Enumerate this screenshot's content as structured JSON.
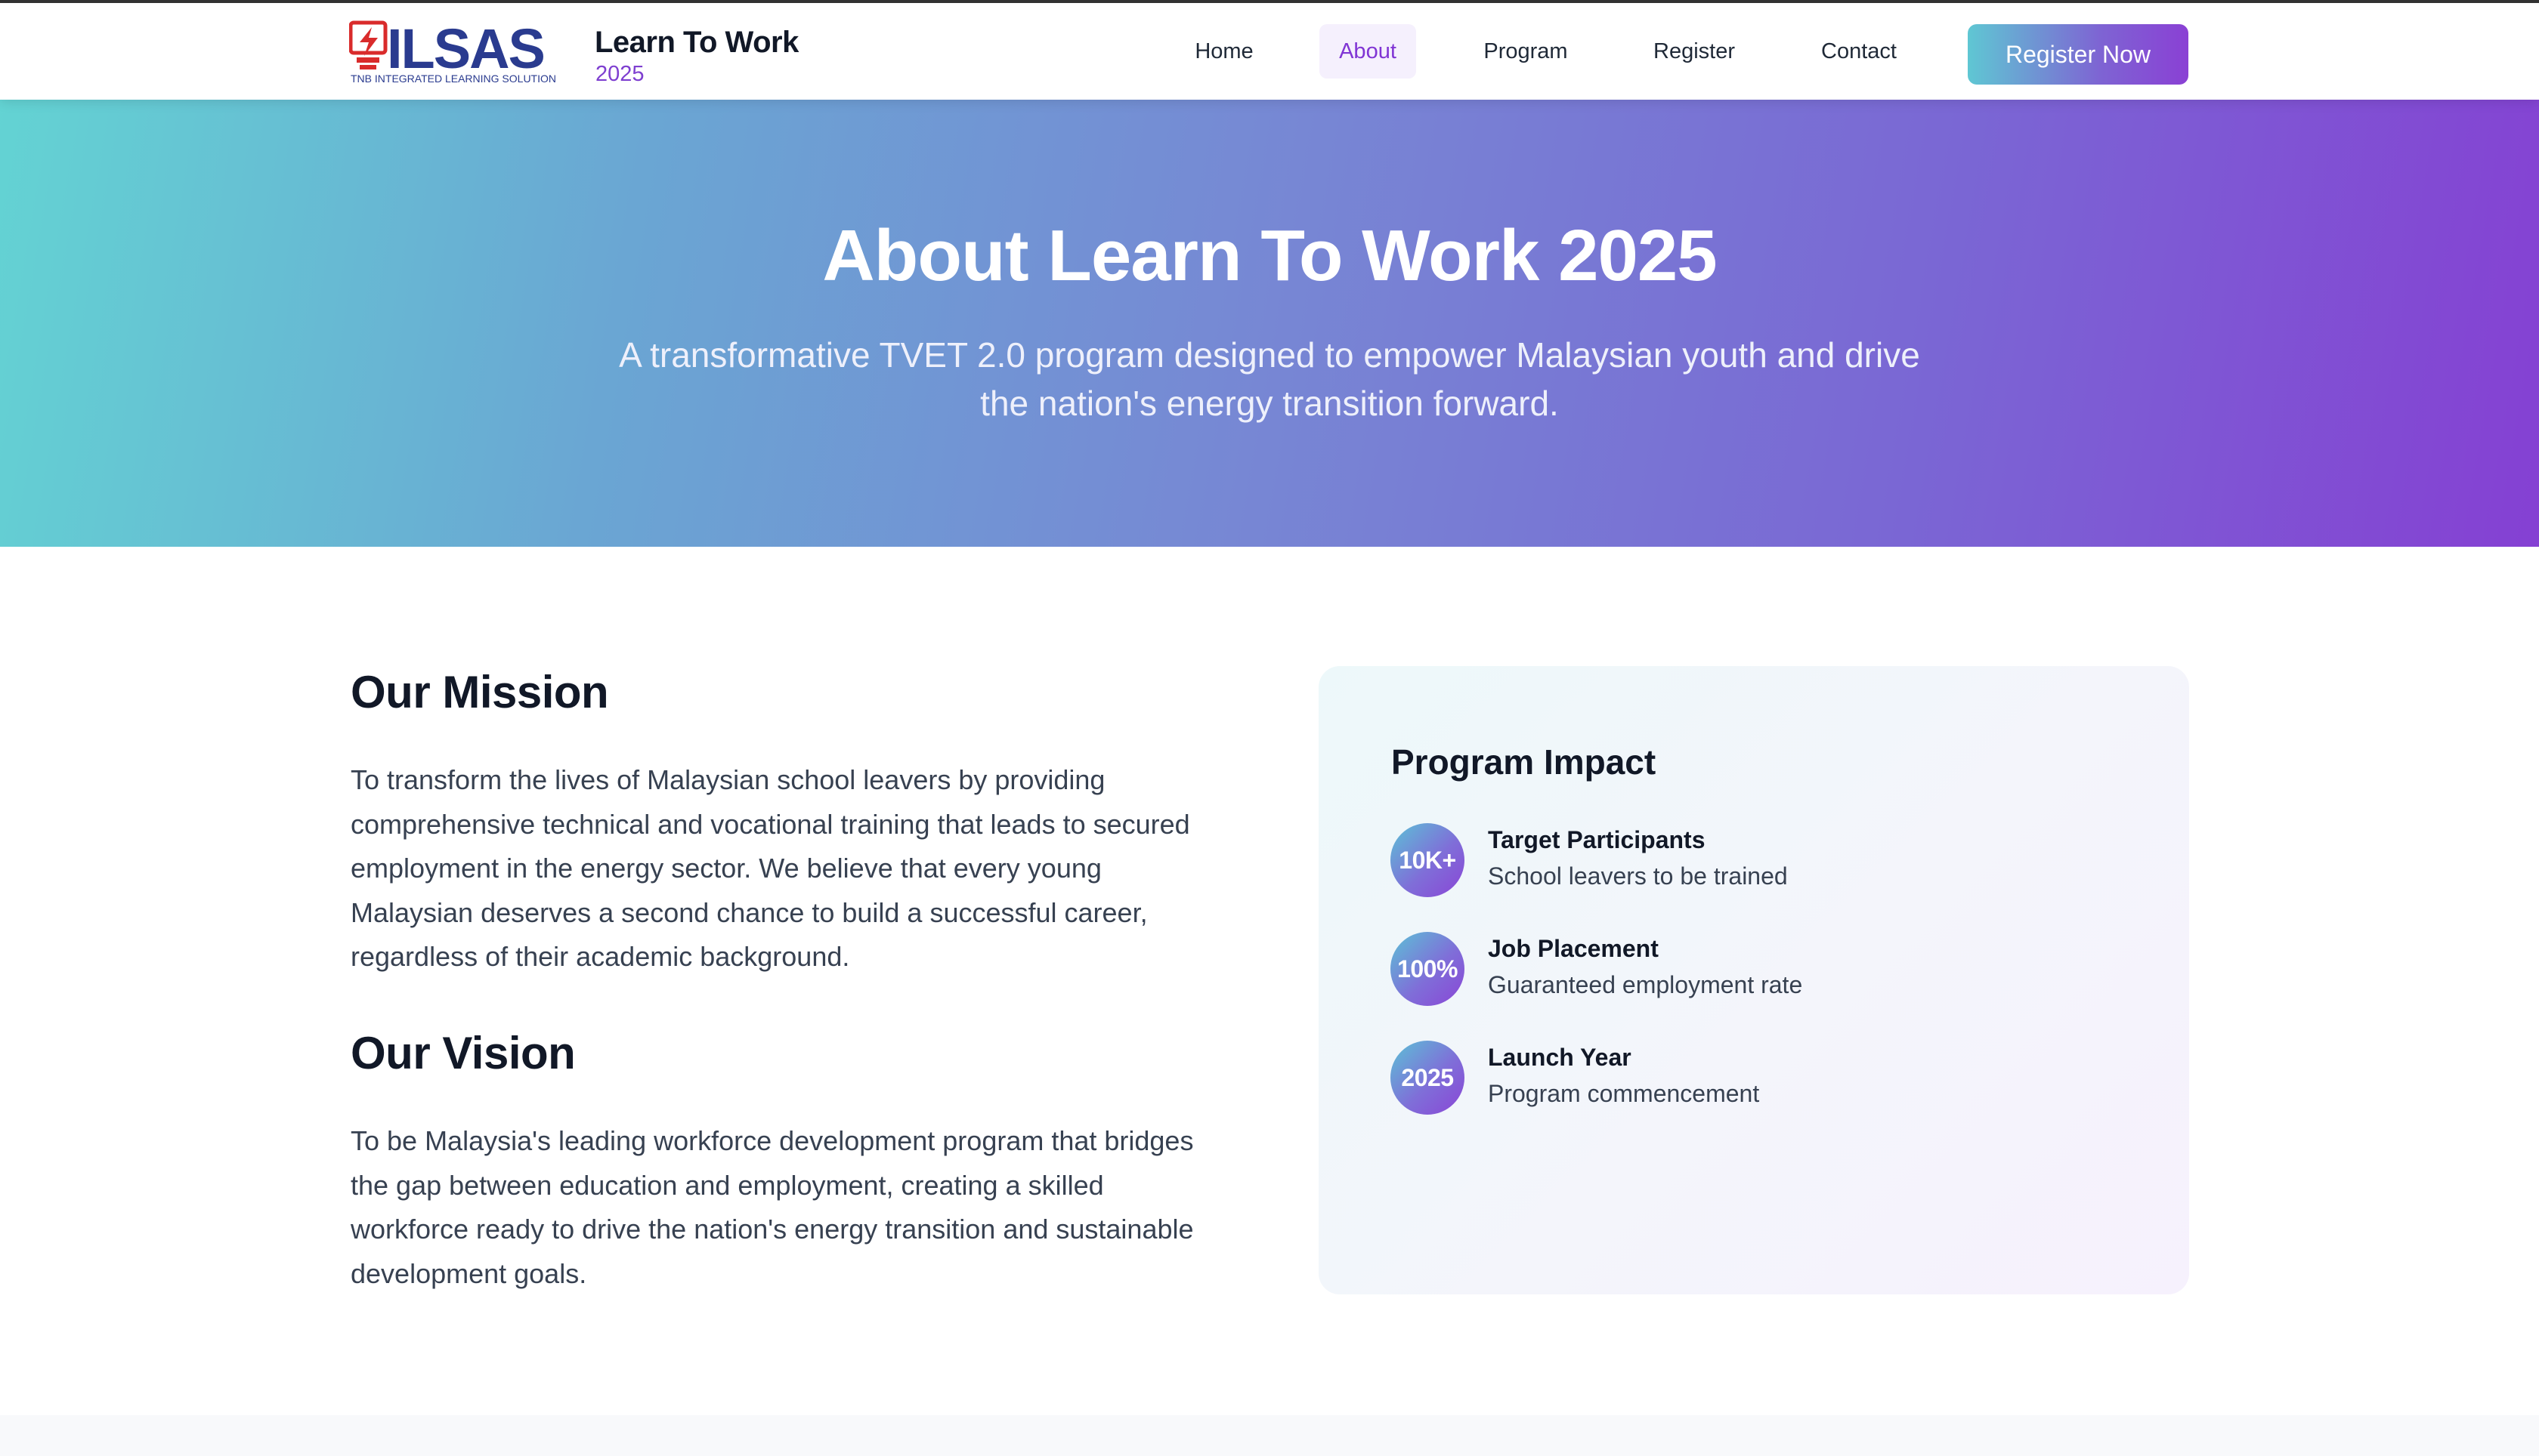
{
  "header": {
    "logo": {
      "text": "ILSAS",
      "tagline": "TNB INTEGRATED LEARNING SOLUTION",
      "icon": "lightning-bolt-icon"
    },
    "brand_title": "Learn To Work",
    "brand_year": "2025",
    "nav": [
      {
        "label": "Home",
        "active": false
      },
      {
        "label": "About",
        "active": true
      },
      {
        "label": "Program",
        "active": false
      },
      {
        "label": "Register",
        "active": false
      },
      {
        "label": "Contact",
        "active": false
      }
    ],
    "cta_label": "Register Now"
  },
  "hero": {
    "title": "About Learn To Work 2025",
    "subtitle_line1": "A transformative TVET 2.0 program designed to empower Malaysian youth and drive",
    "subtitle_line2": "the nation's energy transition forward."
  },
  "mission": {
    "heading": "Our Mission",
    "body": "To transform the lives of Malaysian school leavers by providing comprehensive technical and vocational training that leads to secured employment in the energy sector. We believe that every young Malaysian deserves a second chance to build a successful career, regardless of their academic background."
  },
  "vision": {
    "heading": "Our Vision",
    "body": "To be Malaysia's leading workforce development program that bridges the gap between education and employment, creating a skilled workforce ready to drive the nation's energy transition and sustainable development goals."
  },
  "impact": {
    "title": "Program Impact",
    "stats": [
      {
        "value": "10K+",
        "label": "Target Participants",
        "desc": "School leavers to be trained"
      },
      {
        "value": "100%",
        "label": "Job Placement",
        "desc": "Guaranteed employment rate"
      },
      {
        "value": "2025",
        "label": "Launch Year",
        "desc": "Program commencement"
      }
    ]
  },
  "colors": {
    "accent_purple": "#8035d4",
    "gradient_start": "#63d3d3",
    "gradient_end": "#8540d3",
    "logo_blue": "#2a3b8f",
    "logo_red": "#d92b2b"
  }
}
